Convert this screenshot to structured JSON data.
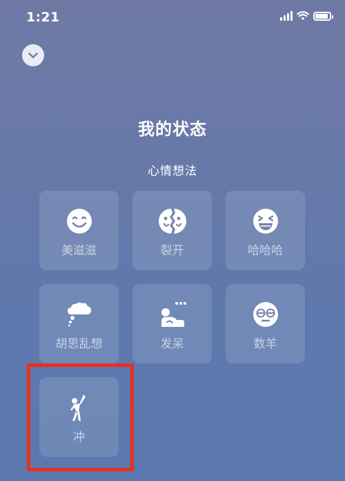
{
  "status_bar": {
    "time": "1:21"
  },
  "header": {
    "title": "我的状态"
  },
  "section": {
    "title": "心情想法"
  },
  "moods": [
    {
      "label": "美滋滋",
      "icon": "smiling-face-icon"
    },
    {
      "label": "裂开",
      "icon": "split-face-icon"
    },
    {
      "label": "哈哈哈",
      "icon": "laughing-face-icon"
    },
    {
      "label": "胡思乱想",
      "icon": "thought-bubble-icon"
    },
    {
      "label": "发呆",
      "icon": "daydreaming-icon"
    },
    {
      "label": "数羊",
      "icon": "sleepy-face-icon"
    },
    {
      "label": "冲",
      "icon": "cheering-person-icon"
    }
  ],
  "colors": {
    "background_top": "#6f7aa5",
    "background_bottom": "#5b79ae",
    "highlight": "#e8311d"
  }
}
